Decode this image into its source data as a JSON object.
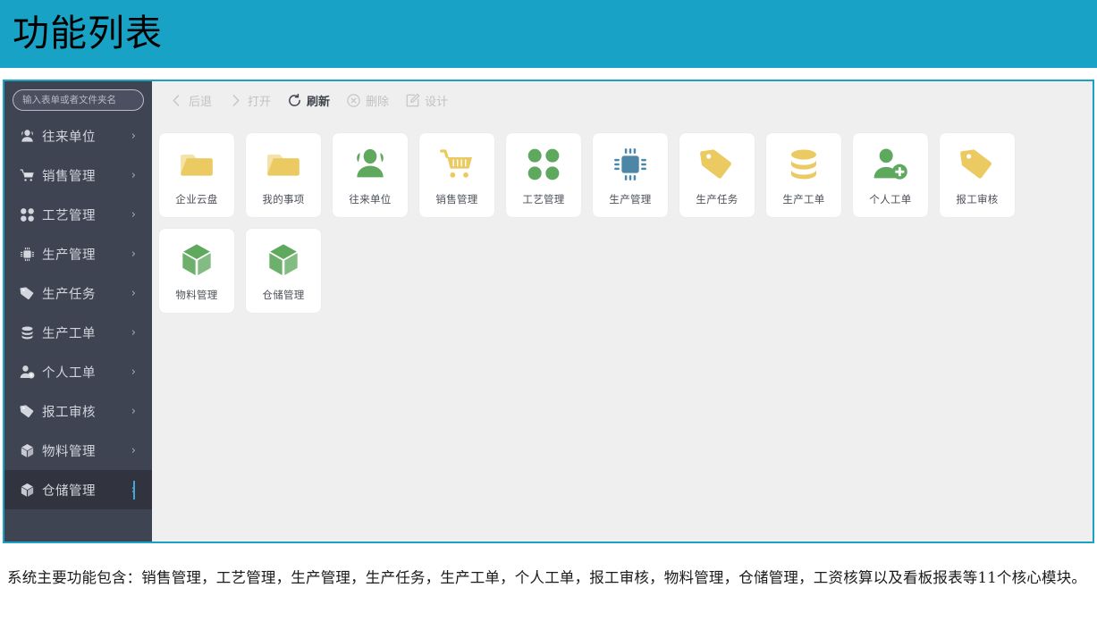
{
  "header": {
    "title": "功能列表",
    "background_color": "#17a2c6"
  },
  "sidebar": {
    "background_color": "#3f4453",
    "search": {
      "placeholder": "输入表单或者文件夹名",
      "value": ""
    },
    "items": [
      {
        "label": "往来单位",
        "icon": "people-icon",
        "arrow": "›",
        "active": false
      },
      {
        "label": "销售管理",
        "icon": "cart-icon",
        "arrow": "›",
        "active": false
      },
      {
        "label": "工艺管理",
        "icon": "clover-icon",
        "arrow": "›",
        "active": false
      },
      {
        "label": "生产管理",
        "icon": "chip-icon",
        "arrow": "›",
        "active": false
      },
      {
        "label": "生产任务",
        "icon": "tag-icon",
        "arrow": "›",
        "active": false
      },
      {
        "label": "生产工单",
        "icon": "database-icon",
        "arrow": "›",
        "active": false
      },
      {
        "label": "个人工单",
        "icon": "person-add-icon",
        "arrow": "›",
        "active": false
      },
      {
        "label": "报工审核",
        "icon": "tag-icon",
        "arrow": "›",
        "active": false
      },
      {
        "label": "物料管理",
        "icon": "cube-icon",
        "arrow": "›",
        "active": false
      },
      {
        "label": "仓储管理",
        "icon": "cube-icon",
        "arrow": "›",
        "active": true
      }
    ]
  },
  "toolbar": {
    "buttons": [
      {
        "label": "后退",
        "icon": "chevron-left-icon",
        "enabled": false
      },
      {
        "label": "打开",
        "icon": "chevron-right-icon",
        "enabled": false
      },
      {
        "label": "刷新",
        "icon": "refresh-icon",
        "enabled": true
      },
      {
        "label": "删除",
        "icon": "delete-circle-icon",
        "enabled": false
      },
      {
        "label": "设计",
        "icon": "design-pencil-icon",
        "enabled": false
      }
    ]
  },
  "tiles": [
    {
      "label": "企业云盘",
      "icon": "folder-icon",
      "color": "#ebca62"
    },
    {
      "label": "我的事项",
      "icon": "folder-icon",
      "color": "#ebca62"
    },
    {
      "label": "往来单位",
      "icon": "people-icon",
      "color": "#5fa95f"
    },
    {
      "label": "销售管理",
      "icon": "cart-icon",
      "color": "#ebca62"
    },
    {
      "label": "工艺管理",
      "icon": "clover-icon",
      "color": "#5fa95f"
    },
    {
      "label": "生产管理",
      "icon": "chip-icon",
      "color": "#4c87a8"
    },
    {
      "label": "生产任务",
      "icon": "tag-icon",
      "color": "#ebca62"
    },
    {
      "label": "生产工单",
      "icon": "database-icon",
      "color": "#ebca62"
    },
    {
      "label": "个人工单",
      "icon": "person-add-icon",
      "color": "#5fa95f"
    },
    {
      "label": "报工审核",
      "icon": "tag-icon",
      "color": "#ebca62"
    },
    {
      "label": "物料管理",
      "icon": "cube-icon",
      "color": "#5fa95f"
    },
    {
      "label": "仓储管理",
      "icon": "cube-icon",
      "color": "#5fa95f"
    }
  ],
  "caption": {
    "text": "系统主要功能包含：销售管理，工艺管理，生产管理，生产任务，生产工单，个人工单，报工审核，物料管理，仓储管理，工资核算以及看板报表等11个核心模块。"
  }
}
